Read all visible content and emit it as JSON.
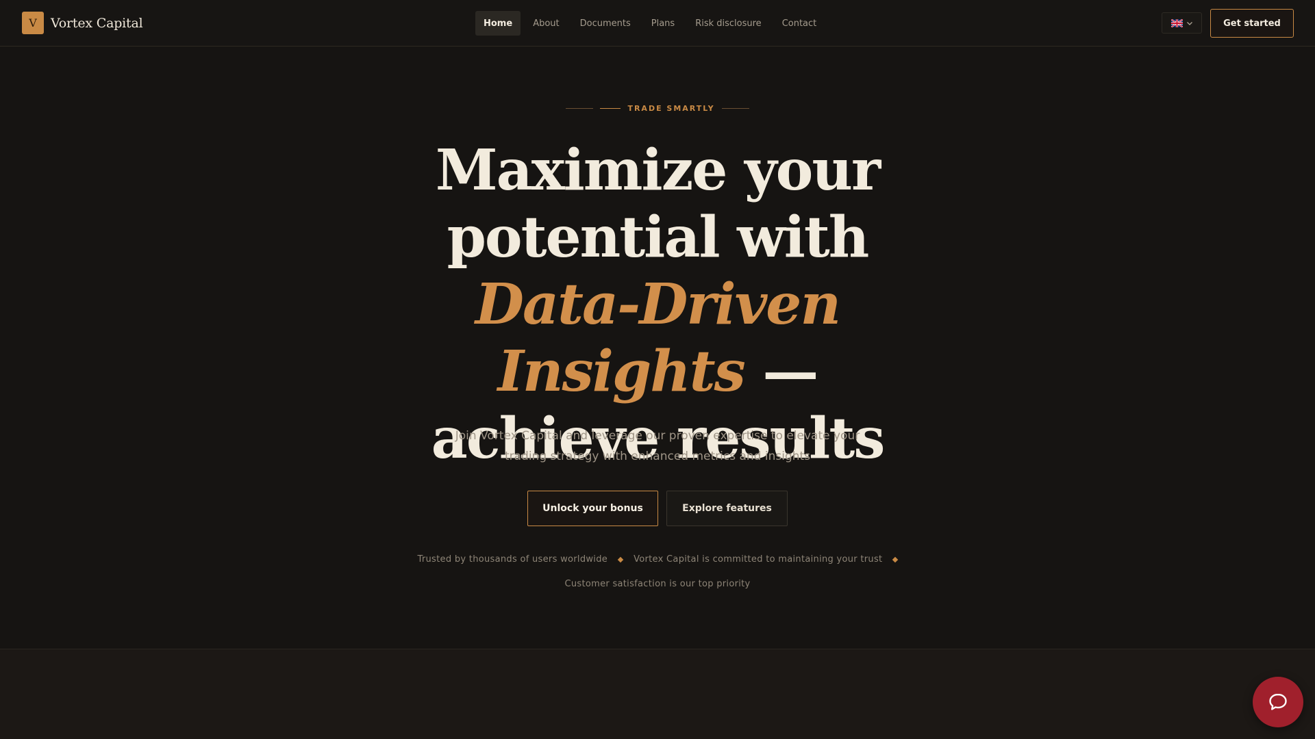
{
  "brand": {
    "mark": "V",
    "name": "Vortex Capital"
  },
  "nav": {
    "items": [
      {
        "label": "Home",
        "active": true
      },
      {
        "label": "About",
        "active": false
      },
      {
        "label": "Documents",
        "active": false
      },
      {
        "label": "Plans",
        "active": false
      },
      {
        "label": "Risk disclosure",
        "active": false
      },
      {
        "label": "Contact",
        "active": false
      }
    ]
  },
  "language": {
    "flag_icon": "uk-flag-icon",
    "chevron_icon": "chevron-down-icon"
  },
  "header_cta": {
    "label": "Get started"
  },
  "hero": {
    "eyebrow": "TRADE SMARTLY",
    "headline_part1": "Maximize your potential with ",
    "headline_accent": "Data-Driven Insights",
    "headline_part2": " — achieve results",
    "subtitle": "Join Vortex Capital and leverage our proven expertise to elevate your trading strategy with enhanced metrics and insights",
    "primary_button": "Unlock your bonus",
    "secondary_button": "Explore features",
    "trust": [
      "Trusted by thousands of users worldwide",
      "Vortex Capital is committed to maintaining your trust",
      "Customer satisfaction is our top priority"
    ]
  },
  "chat": {
    "icon": "chat-bubble-icon"
  },
  "colors": {
    "background": "#161412",
    "accent": "#c98a45",
    "accent_text": "#d28f4b",
    "chat": "#a0202c"
  }
}
